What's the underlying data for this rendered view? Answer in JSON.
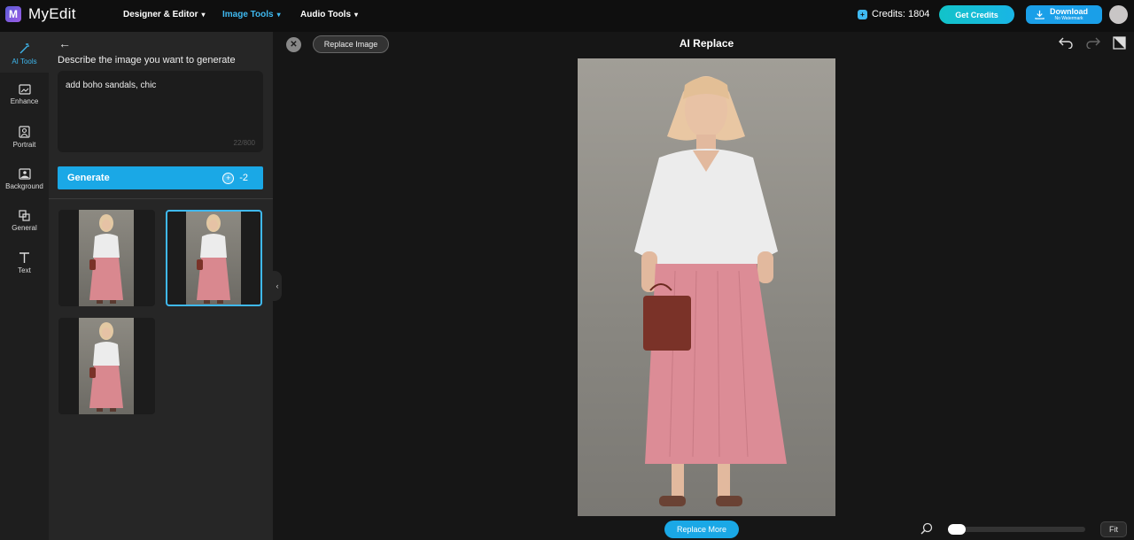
{
  "app": {
    "logo_letter": "M",
    "name": "MyEdit"
  },
  "nav": [
    {
      "label": "Designer & Editor",
      "active": false
    },
    {
      "label": "Image Tools",
      "active": true
    },
    {
      "label": "Audio Tools",
      "active": false
    }
  ],
  "header": {
    "credits_label": "Credits: 1804",
    "get_credits_label": "Get Credits",
    "download_label": "Download",
    "download_sub": "No Watermark"
  },
  "rail": [
    {
      "label": "AI Tools",
      "icon": "magic-wand-icon",
      "active": true
    },
    {
      "label": "Enhance",
      "icon": "enhance-icon",
      "active": false
    },
    {
      "label": "Portrait",
      "icon": "portrait-icon",
      "active": false
    },
    {
      "label": "Background",
      "icon": "background-icon",
      "active": false
    },
    {
      "label": "General",
      "icon": "general-icon",
      "active": false
    },
    {
      "label": "Text",
      "icon": "text-icon",
      "active": false
    }
  ],
  "panel": {
    "title": "Describe the image you want to generate",
    "prompt_value": "add boho sandals, chic",
    "counter": "22/800",
    "generate_label": "Generate",
    "generate_cost": "-2",
    "results_count": 3,
    "selected_index": 1
  },
  "canvas": {
    "replace_image_label": "Replace Image",
    "title": "AI Replace",
    "replace_more_label": "Replace More",
    "fit_label": "Fit",
    "zoom_level": 0.05
  },
  "colors": {
    "accent": "#1aa8e6",
    "active_text": "#3fb9f0",
    "topbar_bg": "#0f0f0f",
    "panel_bg": "#262626",
    "canvas_bg": "#161616"
  }
}
